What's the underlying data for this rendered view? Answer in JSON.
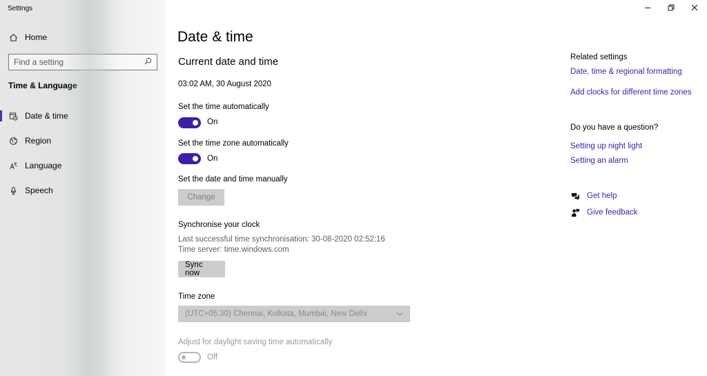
{
  "window": {
    "title": "Settings",
    "controls": {
      "minimize_icon": "minimize-icon",
      "restore_icon": "restore-icon",
      "close_icon": "close-icon"
    }
  },
  "sidebar": {
    "home_label": "Home",
    "search_placeholder": "Find a setting",
    "section_title": "Time & Language",
    "items": [
      {
        "label": "Date & time",
        "icon": "calendar-clock-icon",
        "active": true
      },
      {
        "label": "Region",
        "icon": "globe-icon",
        "active": false
      },
      {
        "label": "Language",
        "icon": "language-icon",
        "active": false
      },
      {
        "label": "Speech",
        "icon": "microphone-icon",
        "active": false
      }
    ]
  },
  "main": {
    "title": "Date & time",
    "subtitle": "Current date and time",
    "current_datetime": "03:02 AM, 30 August 2020",
    "set_time_auto": {
      "label": "Set the time automatically",
      "state": "On"
    },
    "set_timezone_auto": {
      "label": "Set the time zone automatically",
      "state": "On"
    },
    "set_manual": {
      "label": "Set the date and time manually",
      "button": "Change"
    },
    "sync": {
      "title": "Synchronise your clock",
      "last_sync": "Last successful time synchronisation: 30-08-2020 02:52:16",
      "server": "Time server: time.windows.com",
      "button": "Sync now"
    },
    "timezone": {
      "label": "Time zone",
      "value": "(UTC+05:30) Chennai, Kolkata, Mumbai, New Delhi"
    },
    "dst": {
      "label": "Adjust for daylight saving time automatically",
      "state": "Off"
    },
    "accent_color": "#3d1fa8"
  },
  "right": {
    "related_title": "Related settings",
    "related_links": [
      "Date, time & regional formatting",
      "Add clocks for different time zones"
    ],
    "question_title": "Do you have a question?",
    "question_links": [
      "Setting up night light",
      "Setting an alarm"
    ],
    "get_help": "Get help",
    "give_feedback": "Give feedback"
  }
}
